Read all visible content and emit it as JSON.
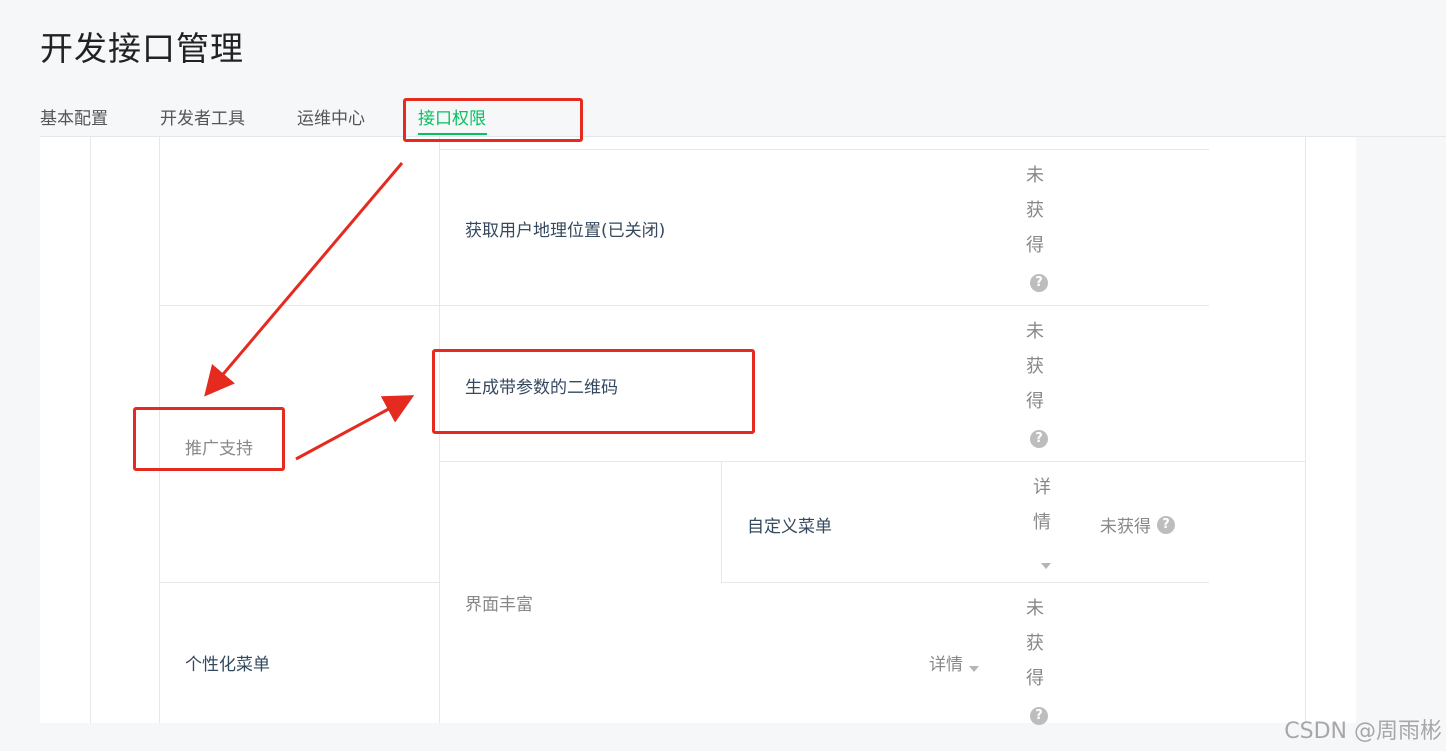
{
  "page": {
    "title": "开发接口管理"
  },
  "tabs": [
    {
      "label": "基本配置"
    },
    {
      "label": "开发者工具"
    },
    {
      "label": "运维中心"
    },
    {
      "label": "接口权限",
      "active": true
    }
  ],
  "table": {
    "rows": [
      {
        "name": "获取用户地理位置(已关闭)",
        "status": "未获得"
      },
      {
        "name": "生成带参数的二维码",
        "status": "未获得"
      },
      {
        "name": "自定义菜单",
        "detail": "详情",
        "status": "未获得"
      },
      {
        "name": "个性化菜单",
        "detail": "详情",
        "status": "未获得"
      }
    ],
    "categories": [
      "推广支持",
      "界面丰富"
    ],
    "help_glyph": "?"
  },
  "colors": {
    "accent": "#07c160",
    "annotation": "#e52a1f",
    "link_text": "#35495e",
    "muted_text": "#888888"
  },
  "watermark": "CSDN @周雨彬"
}
